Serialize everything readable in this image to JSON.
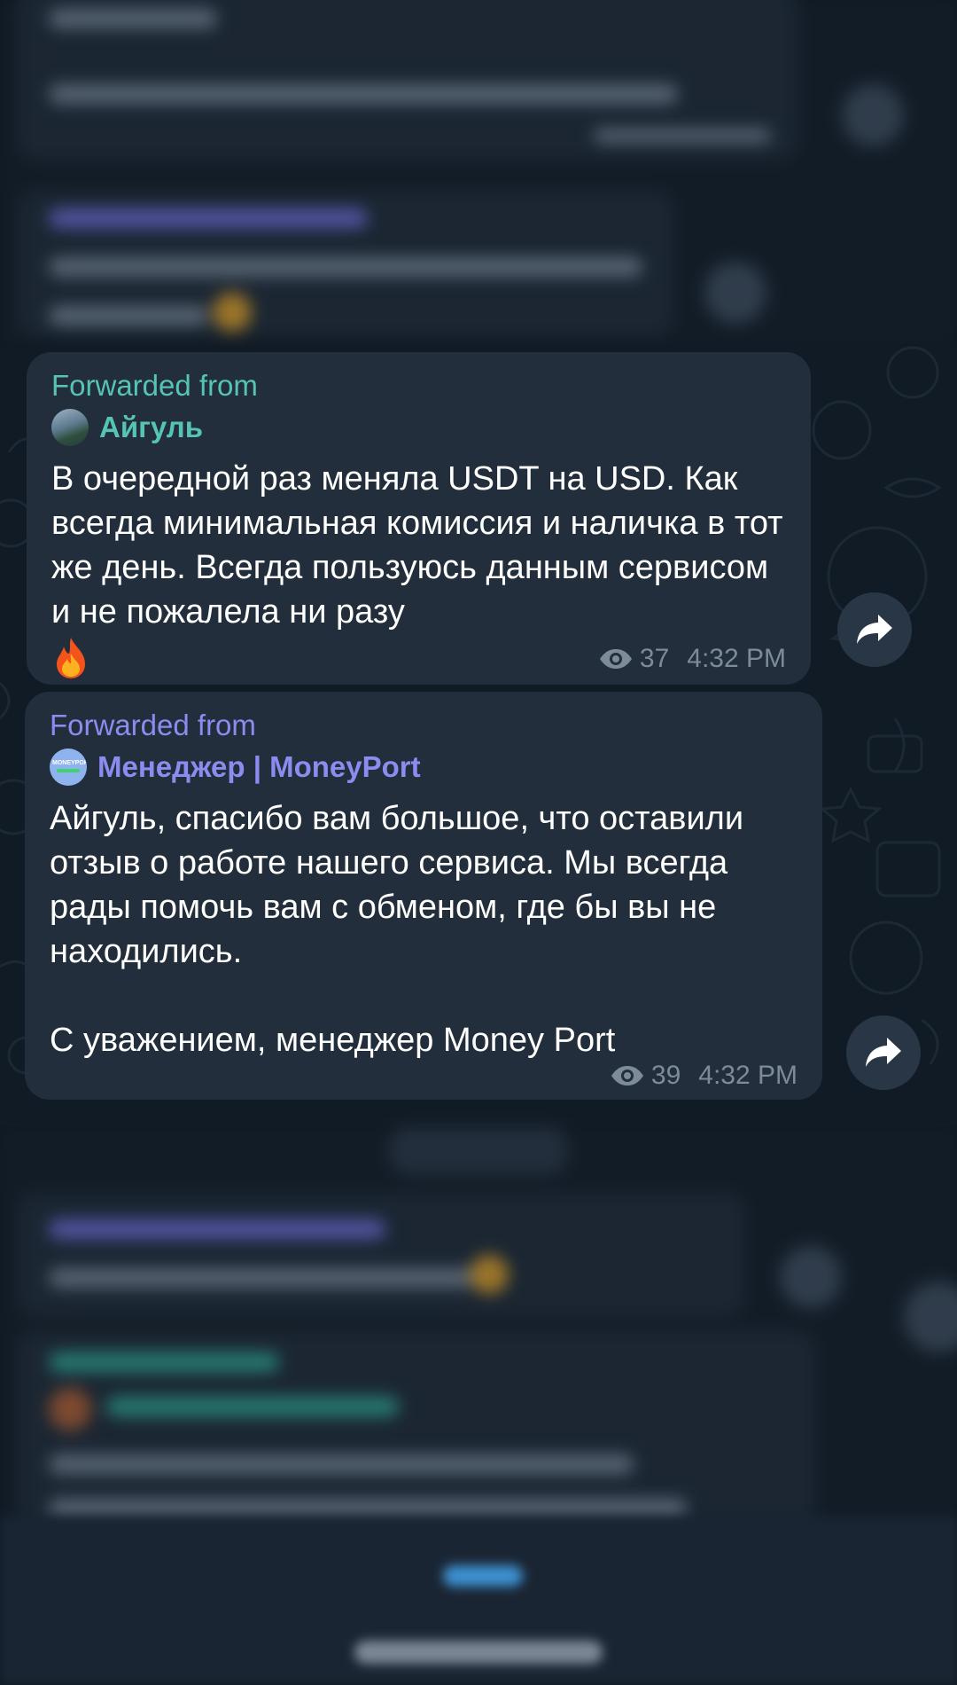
{
  "messages": [
    {
      "forwarded_label": "Forwarded from",
      "source_name": "Айгуль",
      "text": "В очередной раз меняла USDT на USD. Как всегда минимальная комиссия и наличка в тот же день. Всегда пользуюсь данным сервисом и не пожалела ни разу",
      "emoji": "fire-emoji",
      "views": "37",
      "time": "4:32 PM",
      "accent": "#56c4b5"
    },
    {
      "forwarded_label": "Forwarded from",
      "source_name": "Менеджер | MoneyPort",
      "avatar_text": "MONEYPORT",
      "text_paragraph_1": "Айгуль, спасибо вам большое, что оставили отзыв о работе нашего сервиса. Мы всегда рады помочь вам с обменом, где бы вы не находились.",
      "text_paragraph_2": "С уважением, менеджер Money Port",
      "views": "39",
      "time": "4:32 PM",
      "accent": "#8c8cf0"
    }
  ],
  "icons": {
    "views": "eye-icon",
    "share": "share-arrow-icon"
  },
  "colors": {
    "background": "#0f1822",
    "bubble": "#222e3b",
    "meta": "#7d8a98"
  }
}
